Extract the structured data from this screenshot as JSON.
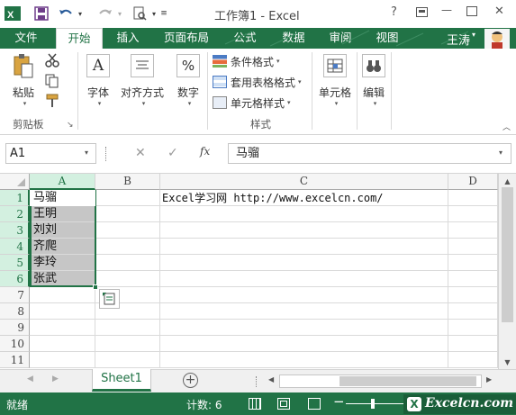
{
  "window": {
    "title": "工作簿1 - Excel",
    "help": "?",
    "min": "—",
    "close": "✕"
  },
  "ribbon_tabs": [
    "文件",
    "开始",
    "插入",
    "页面布局",
    "公式",
    "数据",
    "审阅",
    "视图"
  ],
  "user": {
    "name": "王涛"
  },
  "ribbon": {
    "paste": "粘贴",
    "clipboard_group": "剪贴板",
    "font": "字体",
    "align": "对齐方式",
    "number": "数字",
    "conditional": "条件格式",
    "table_format": "套用表格格式",
    "cell_style": "单元格样式",
    "styles_group": "样式",
    "cells": "单元格",
    "edit": "编辑",
    "icons": {
      "font": "A",
      "number": "%",
      "fx": "fx"
    }
  },
  "formula_bar": {
    "name_box": "A1",
    "formula": "马骝"
  },
  "columns": [
    "A",
    "B",
    "C",
    "D"
  ],
  "rows": [
    "1",
    "2",
    "3",
    "4",
    "5",
    "6",
    "7",
    "8",
    "9",
    "10",
    "11"
  ],
  "cells": {
    "A": [
      "马骝",
      "王明",
      "刘刘",
      "齐爬",
      "李玲",
      "张武"
    ],
    "C1": "Excel学习网 http://www.excelcn.com/"
  },
  "sheet_tabs": [
    "Sheet1"
  ],
  "status": {
    "ready": "就绪",
    "count": "计数: 6",
    "watermark": "Excelcn.com"
  },
  "colors": {
    "accent": "#217346",
    "selection": "#c6c6c6"
  }
}
